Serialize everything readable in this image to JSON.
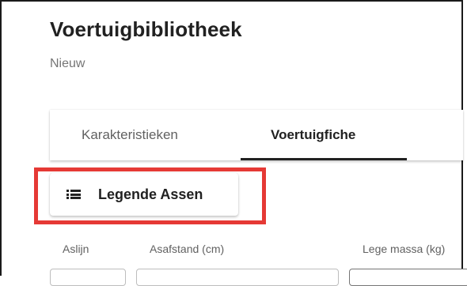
{
  "page": {
    "title": "Voertuigbibliotheek",
    "subtitle": "Nieuw"
  },
  "tabs": [
    {
      "label": "Karakteristieken",
      "active": false
    },
    {
      "label": "Voertuigfiche",
      "active": true
    }
  ],
  "legend_button": {
    "icon": "list-icon",
    "label": "Legende Assen"
  },
  "table": {
    "columns": [
      "Aslijn",
      "Asafstand (cm)",
      "Lege massa (kg)"
    ]
  },
  "colors": {
    "highlight": "#e53935",
    "active_tab_indicator": "#212121",
    "text_primary": "#212121",
    "text_secondary": "#757575"
  }
}
